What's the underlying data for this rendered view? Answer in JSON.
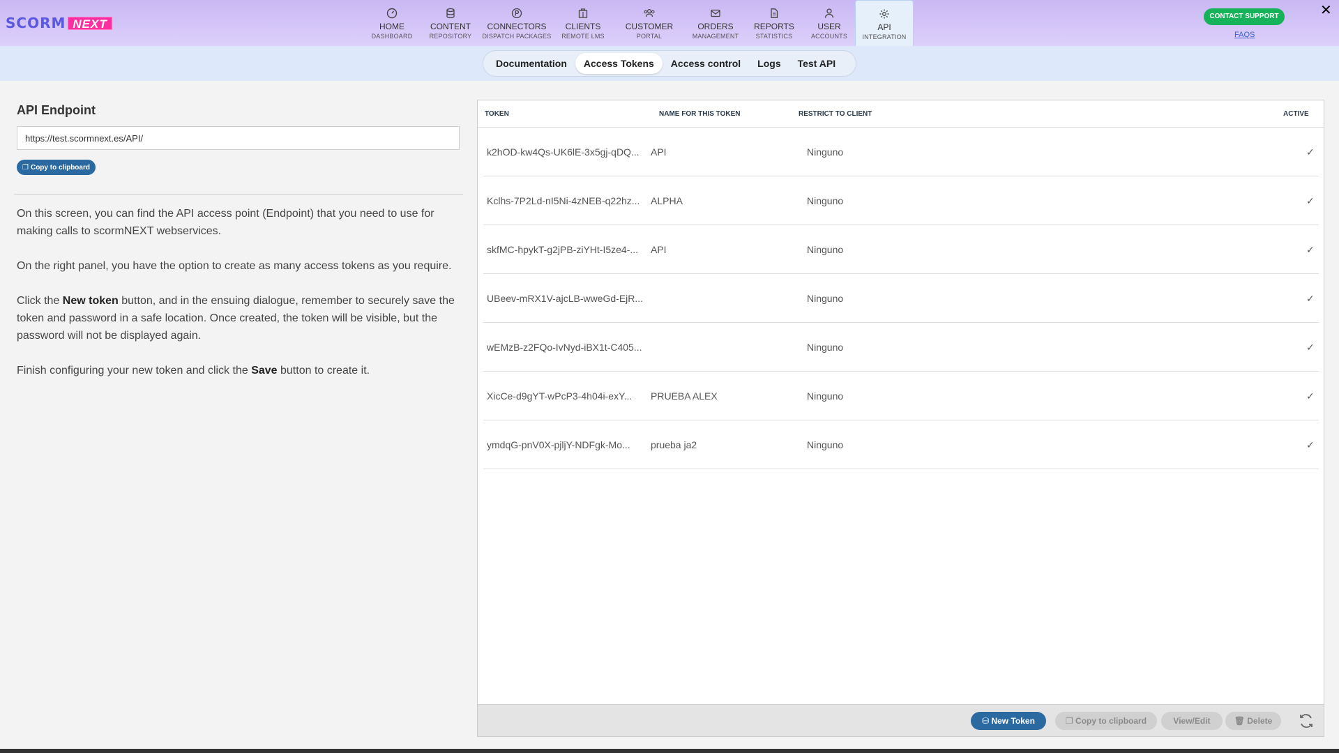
{
  "app": {
    "logo_left": "SCORM",
    "logo_right": "NEXT"
  },
  "nav": [
    {
      "title": "HOME",
      "sub": "DASHBOARD",
      "icon": "gauge-icon"
    },
    {
      "title": "CONTENT",
      "sub": "REPOSITORY",
      "icon": "database-icon"
    },
    {
      "title": "CONNECTORS",
      "sub": "DISPATCH PACKAGES",
      "icon": "p-circle-icon"
    },
    {
      "title": "CLIENTS",
      "sub": "REMOTE LMS",
      "icon": "building-icon"
    },
    {
      "title": "CUSTOMER",
      "sub": "PORTAL",
      "icon": "users-icon"
    },
    {
      "title": "ORDERS",
      "sub": "MANAGEMENT",
      "icon": "envelope-icon"
    },
    {
      "title": "REPORTS",
      "sub": "STATISTICS",
      "icon": "document-icon"
    },
    {
      "title": "USER",
      "sub": "ACCOUNTS",
      "icon": "user-icon"
    },
    {
      "title": "API",
      "sub": "INTEGRATION",
      "icon": "gear-icon"
    }
  ],
  "header": {
    "contact_label": "CONTACT SUPPORT",
    "faqs_label": "FAQS",
    "close_label": "✕"
  },
  "subnav": {
    "tabs": [
      "Documentation",
      "Access Tokens",
      "Access control",
      "Logs",
      "Test API"
    ],
    "active": "Access Tokens"
  },
  "endpoint": {
    "title": "API Endpoint",
    "value": "https://test.scormnext.es/API/",
    "copy_label": "Copy to clipboard"
  },
  "description": {
    "p1": "On this screen, you can find the API access point (Endpoint) that you need to use for making calls to scormNEXT webservices.",
    "p2": "On the right panel, you have the option to create as many access tokens as you require.",
    "p3_a": "Click the ",
    "p3_b": "New token",
    "p3_c": " button, and in the ensuing dialogue, remember to securely save the token and password in a safe location. Once created, the token will be visible, but the password will not be displayed again.",
    "p4_a": "Finish configuring your new token and click the ",
    "p4_b": "Save",
    "p4_c": " button to create it."
  },
  "table": {
    "headers": {
      "token": "TOKEN",
      "name": "NAME FOR THIS TOKEN",
      "client": "RESTRICT TO CLIENT",
      "active": "ACTIVE"
    },
    "rows": [
      {
        "token": "k2hOD-kw4Qs-UK6lE-3x5gj-qDQ...",
        "name": "API",
        "client": "Ninguno",
        "active": "✓"
      },
      {
        "token": "Kclhs-7P2Ld-nI5Ni-4zNEB-q22hz...",
        "name": "ALPHA",
        "client": "Ninguno",
        "active": "✓"
      },
      {
        "token": "skfMC-hpykT-g2jPB-ziYHt-I5ze4-...",
        "name": "API",
        "client": "Ninguno",
        "active": "✓"
      },
      {
        "token": "UBeev-mRX1V-ajcLB-wweGd-EjR...",
        "name": "",
        "client": "Ninguno",
        "active": "✓"
      },
      {
        "token": "wEMzB-z2FQo-IvNyd-iBX1t-C405...",
        "name": "",
        "client": "Ninguno",
        "active": "✓"
      },
      {
        "token": "XicCe-d9gYT-wPcP3-4h04i-exY...",
        "name": "PRUEBA ALEX",
        "client": "Ninguno",
        "active": "✓"
      },
      {
        "token": "ymdqG-pnV0X-pjljY-NDFgk-Mo...",
        "name": "prueba ja2",
        "client": "Ninguno",
        "active": "✓"
      }
    ]
  },
  "footer": {
    "new_token": "New Token",
    "copy": "Copy to clipboard",
    "view_edit": "View/Edit",
    "delete": "Delete"
  }
}
